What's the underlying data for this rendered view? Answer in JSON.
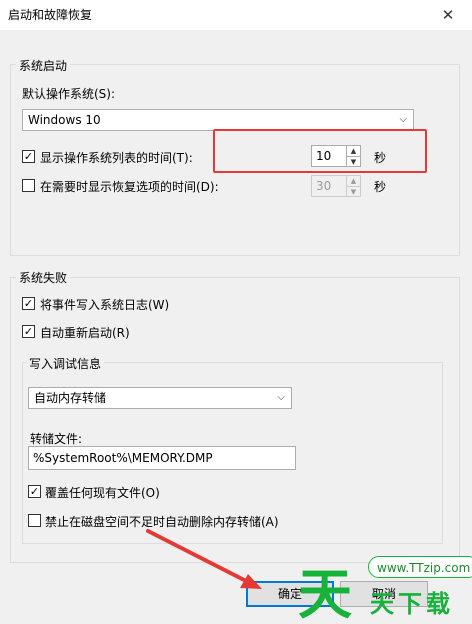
{
  "window": {
    "title": "启动和故障恢复",
    "close_glyph": "✕"
  },
  "startup": {
    "group_label": "系统启动",
    "default_os_label": "默认操作系统(S):",
    "default_os_value": "Windows 10",
    "show_list": {
      "checked": true,
      "label": "显示操作系统列表的时间(T):",
      "value": "10",
      "unit": "秒"
    },
    "show_recovery": {
      "checked": false,
      "label": "在需要时显示恢复选项的时间(D):",
      "value": "30",
      "unit": "秒"
    }
  },
  "failure": {
    "group_label": "系统失败",
    "write_event": {
      "checked": true,
      "label": "将事件写入系统日志(W)"
    },
    "auto_restart": {
      "checked": true,
      "label": "自动重新启动(R)"
    },
    "debug": {
      "group_label": "写入调试信息",
      "type_value": "自动内存转储",
      "dump_file_label": "转储文件:",
      "dump_file_value": "%SystemRoot%\\MEMORY.DMP",
      "overwrite": {
        "checked": true,
        "label": "覆盖任何现有文件(O)"
      },
      "disable_auto_delete": {
        "checked": false,
        "label": "禁止在磁盘空间不足时自动删除内存转储(A)"
      }
    }
  },
  "buttons": {
    "ok": "确定",
    "cancel": "取消"
  },
  "watermark": {
    "logo": "天",
    "url": "www.TTzip.com",
    "text": "天下载"
  },
  "colors": {
    "highlight": "#e53935",
    "accent": "#0078d7",
    "watermark": "#17b23a"
  },
  "icons": {
    "spin_up": "▲",
    "spin_down": "▼",
    "dropdown": "⌵",
    "check": "✓"
  }
}
